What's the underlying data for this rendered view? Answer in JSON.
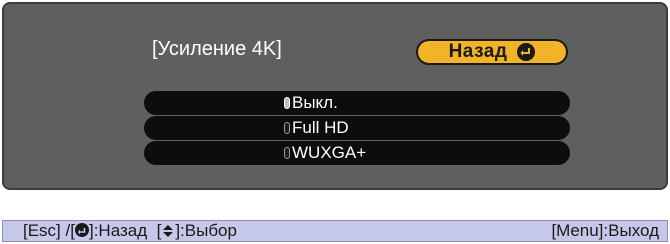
{
  "dialog": {
    "title": "[Усиление 4K]",
    "back_label": "Назад",
    "options": [
      {
        "label": "Выкл.",
        "selected": true
      },
      {
        "label": "Full HD",
        "selected": false
      },
      {
        "label": "WUXGA+",
        "selected": false
      }
    ]
  },
  "footer": {
    "esc": "[Esc] /[",
    "back": "]:Назад",
    "select_open": "[",
    "select": "]:Выбор",
    "menu": "[Menu]:Выход"
  },
  "colors": {
    "accent": "#f3b329",
    "panel": "#5f5f5f",
    "footer": "#c6c8e9"
  },
  "icons": [
    "enter-icon",
    "up-down-arrow-icon"
  ]
}
